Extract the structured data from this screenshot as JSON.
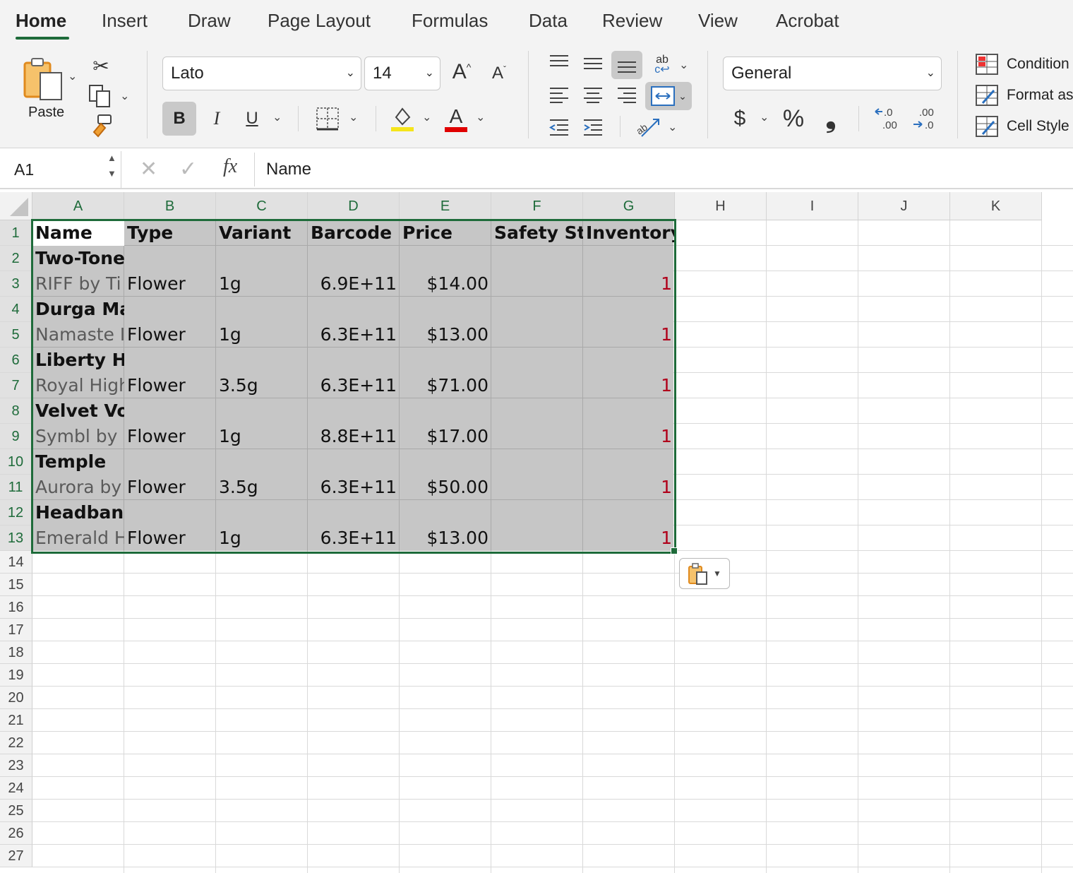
{
  "tabs": [
    "Home",
    "Insert",
    "Draw",
    "Page Layout",
    "Formulas",
    "Data",
    "Review",
    "View",
    "Acrobat"
  ],
  "ribbon": {
    "paste_label": "Paste",
    "font_name": "Lato",
    "font_size": "14",
    "bold": "B",
    "italic": "I",
    "underline": "U",
    "number_format": "General",
    "currency": "$",
    "percent": "%",
    "comma": "❟",
    "styles": [
      "Condition",
      "Format as",
      "Cell Style"
    ],
    "highlight_color": "#f5e51b",
    "font_color": "#e00000"
  },
  "formula_bar": {
    "cell_ref": "A1",
    "fx": "fx",
    "content": "Name"
  },
  "sheet": {
    "columns": [
      "A",
      "B",
      "C",
      "D",
      "E",
      "F",
      "G",
      "H",
      "I",
      "J",
      "K"
    ],
    "rows": [
      "1",
      "2",
      "3",
      "4",
      "5",
      "6",
      "7",
      "8",
      "9",
      "10",
      "11",
      "12",
      "13",
      "14",
      "15",
      "16",
      "17",
      "18",
      "19",
      "20",
      "21",
      "22",
      "23",
      "24",
      "25",
      "26",
      "27"
    ],
    "headers": [
      "Name",
      "Type",
      "Variant",
      "Barcode",
      "Price",
      "Safety Sto",
      "Inventory"
    ],
    "groups": [
      {
        "title": "Two-Tone",
        "name": "RIFF by Ti",
        "type": "Flower",
        "variant": "1g",
        "barcode": "6.9E+11",
        "price": "$14.00",
        "inventory": "1"
      },
      {
        "title": "Durga Ma",
        "name": "Namaste I",
        "type": "Flower",
        "variant": "1g",
        "barcode": "6.3E+11",
        "price": "$13.00",
        "inventory": "1"
      },
      {
        "title": "Liberty Ha",
        "name": "Royal High",
        "type": "Flower",
        "variant": "3.5g",
        "barcode": "6.3E+11",
        "price": "$71.00",
        "inventory": "1"
      },
      {
        "title": "Velvet Voy",
        "name": "Symbl by",
        "type": "Flower",
        "variant": "1g",
        "barcode": "8.8E+11",
        "price": "$17.00",
        "inventory": "1"
      },
      {
        "title": "Temple",
        "name": "Aurora by",
        "type": "Flower",
        "variant": "3.5g",
        "barcode": "6.3E+11",
        "price": "$50.00",
        "inventory": "1"
      },
      {
        "title": "Headband",
        "name": "Emerald H",
        "type": "Flower",
        "variant": "1g",
        "barcode": "6.3E+11",
        "price": "$13.00",
        "inventory": "1"
      }
    ]
  },
  "colors": {
    "accent": "#1e6b3a",
    "selection": "#c6c6c6",
    "inventory_text": "#b0001a"
  }
}
